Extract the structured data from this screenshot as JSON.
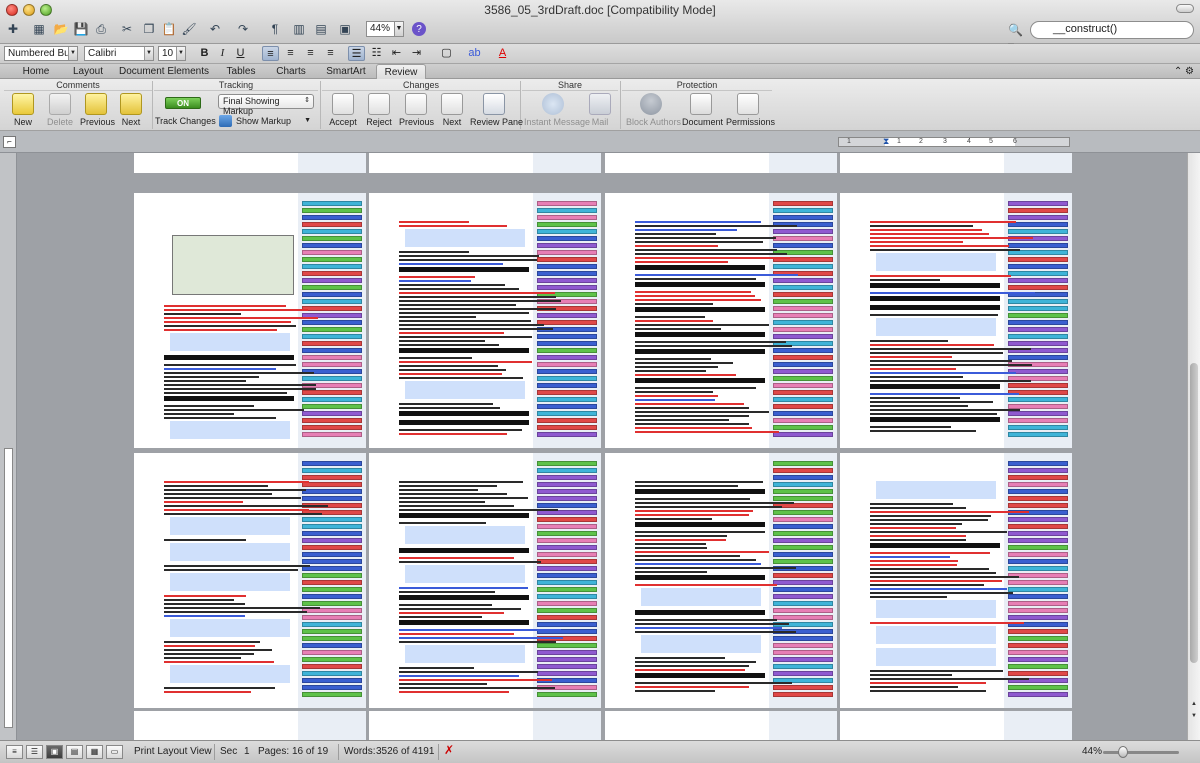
{
  "window": {
    "title": "3586_05_3rdDraft.doc [Compatibility Mode]"
  },
  "toolbar": {
    "zoom_value": "44%",
    "search_value": "__construct()"
  },
  "format_bar": {
    "style": "Numbered Bu...",
    "font": "Calibri",
    "size": "10",
    "bold": "B",
    "italic": "I",
    "underline": "U"
  },
  "tabs": [
    "Home",
    "Layout",
    "Document Elements",
    "Tables",
    "Charts",
    "SmartArt",
    "Review"
  ],
  "active_tab": "Review",
  "ribbon": {
    "groups": {
      "comments": "Comments",
      "tracking": "Tracking",
      "changes": "Changes",
      "share": "Share",
      "protection": "Protection"
    },
    "comments": {
      "new": "New",
      "delete": "Delete",
      "previous": "Previous",
      "next": "Next"
    },
    "tracking": {
      "toggle": "ON",
      "track_changes": "Track Changes",
      "markup_mode": "Final Showing Markup",
      "show_markup": "Show Markup"
    },
    "changes": {
      "accept": "Accept",
      "reject": "Reject",
      "previous": "Previous",
      "next": "Next",
      "review_pane": "Review Pane"
    },
    "share": {
      "instant_message": "Instant Message",
      "mail": "Mail"
    },
    "protection": {
      "block_authors": "Block Authors",
      "document": "Document",
      "permissions": "Permissions"
    }
  },
  "ruler": {
    "labels": [
      "1",
      "2",
      "3",
      "4",
      "5",
      "6"
    ]
  },
  "status": {
    "view": "Print Layout View",
    "sec_label": "Sec",
    "sec_value": "1",
    "pages_label": "Pages:",
    "pages_value": "16 of 19",
    "words_label": "Words:",
    "words_value": "3526 of 4191",
    "zoom": "44%"
  },
  "icons": {
    "accent": "#4a7bd0",
    "track_on_color": "#3b8d1f",
    "insert_color": "#e03030",
    "delete_color": "#3b5bd9"
  }
}
